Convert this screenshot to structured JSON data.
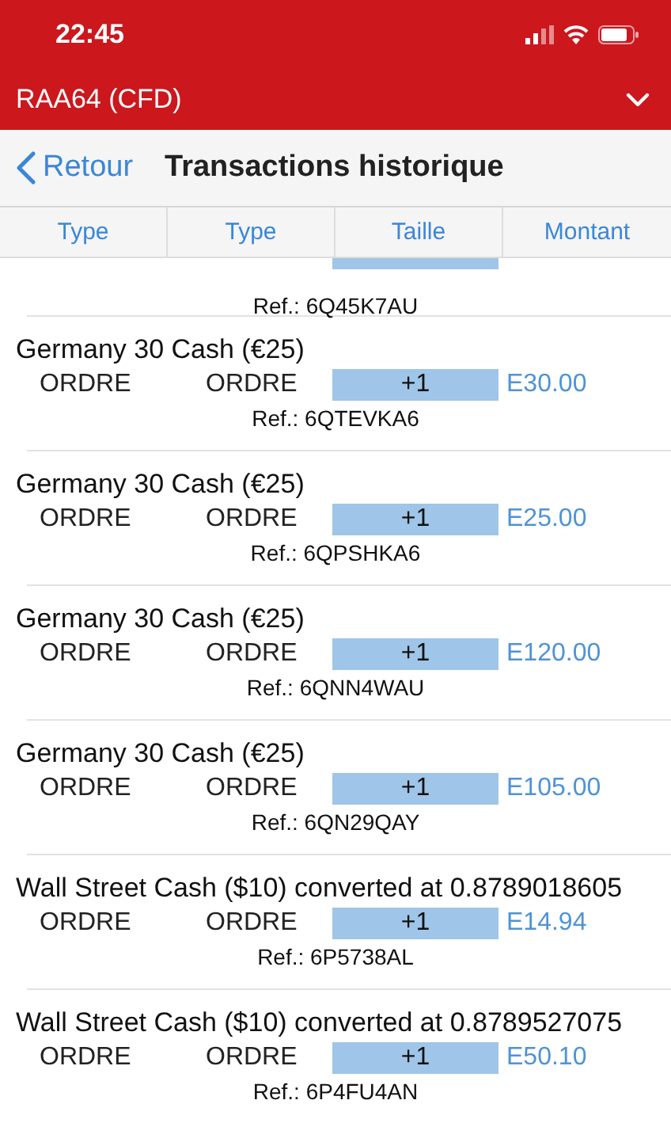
{
  "status_bar": {
    "time": "22:45"
  },
  "account": {
    "title": "RAA64 (CFD)"
  },
  "nav": {
    "back": "Retour",
    "title": "Transactions historique"
  },
  "table": {
    "columns": [
      "Type",
      "Type",
      "Taille",
      "Montant"
    ],
    "partial_row": {
      "ref": "Ref.: 6Q45K7AU"
    },
    "rows": [
      {
        "title": "Germany 30 Cash (€25)",
        "type_1": "ORDRE",
        "type_2": "ORDRE",
        "size": "+1",
        "amount": "E30.00",
        "ref": "Ref.: 6QTEVKA6"
      },
      {
        "title": "Germany 30 Cash (€25)",
        "type_1": "ORDRE",
        "type_2": "ORDRE",
        "size": "+1",
        "amount": "E25.00",
        "ref": "Ref.: 6QPSHKA6"
      },
      {
        "title": "Germany 30 Cash (€25)",
        "type_1": "ORDRE",
        "type_2": "ORDRE",
        "size": "+1",
        "amount": "E120.00",
        "ref": "Ref.: 6QNN4WAU"
      },
      {
        "title": "Germany 30 Cash (€25)",
        "type_1": "ORDRE",
        "type_2": "ORDRE",
        "size": "+1",
        "amount": "E105.00",
        "ref": "Ref.: 6QN29QAY"
      },
      {
        "title": "Wall Street Cash ($10) converted at 0.8789018605",
        "type_1": "ORDRE",
        "type_2": "ORDRE",
        "size": "+1",
        "amount": "E14.94",
        "ref": "Ref.: 6P5738AL"
      },
      {
        "title": "Wall Street Cash ($10) converted at 0.8789527075",
        "type_1": "ORDRE",
        "type_2": "ORDRE",
        "size": "+1",
        "amount": "E50.10",
        "ref": "Ref.: 6P4FU4AN"
      }
    ]
  }
}
